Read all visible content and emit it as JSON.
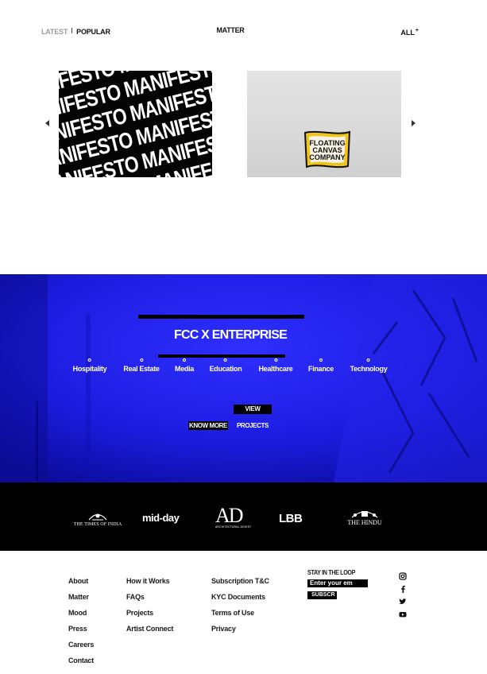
{
  "tabs": {
    "latest": "LATEST",
    "popular": "POPULAR"
  },
  "section_title": "MATTER",
  "all_link": {
    "label": "ALL",
    "sup": "+"
  },
  "carousel": {
    "cards": [
      {
        "art_text": "MANIFESTO MANIFESTO"
      },
      {
        "logo_lines": [
          "FLOATING",
          "CANVAS",
          "COMPANY"
        ]
      }
    ]
  },
  "hero": {
    "title": "FCC X ENTERPRISE",
    "sectors": [
      "Hospitality",
      "Real Estate",
      "Media",
      "Education",
      "Healthcare",
      "Finance",
      "Technology"
    ],
    "view_button": "VIEW",
    "know_more": "KNOW MORE",
    "projects": "PROJECTS"
  },
  "press": {
    "toi": "THE TIMES OF INDIA",
    "midday": "mid-day",
    "ad": "AD",
    "ad_sub": "ARCHITECTURAL DIGEST",
    "lbb": "LBB",
    "hindu": "THE HINDU"
  },
  "footer": {
    "col1": [
      "About",
      "Matter",
      "Mood",
      "Press",
      "Careers",
      "Contact"
    ],
    "col2": [
      "How it Works",
      "FAQs",
      "Projects",
      "Artist Connect"
    ],
    "col3": [
      "Subscription T&C",
      "KYC Documents",
      "Terms of Use",
      "Privacy"
    ],
    "newsletter": {
      "title": "STAY IN THE LOOP",
      "placeholder": "Enter your em",
      "button": "SUBSCR"
    },
    "social": [
      "instagram-icon",
      "facebook-icon",
      "twitter-icon",
      "youtube-icon"
    ]
  },
  "colors": {
    "hero_blue": "#1a1ad6",
    "press_bg": "#000000"
  }
}
